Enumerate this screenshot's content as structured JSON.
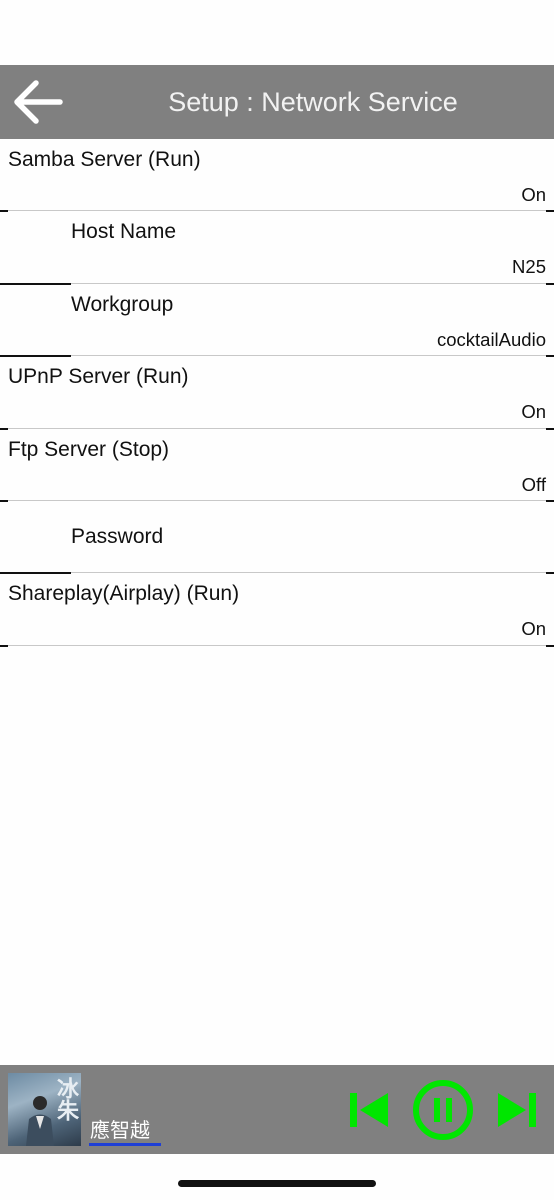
{
  "header": {
    "title": "Setup : Network Service",
    "back_icon": "arrow-left-icon"
  },
  "settings": [
    {
      "title": "Samba Server (Run)",
      "value": "On",
      "indent": false
    },
    {
      "title": "Host Name",
      "value": "N25",
      "indent": true
    },
    {
      "title": "Workgroup",
      "value": "cocktailAudio",
      "indent": true
    },
    {
      "title": "UPnP Server (Run)",
      "value": "On",
      "indent": false
    },
    {
      "title": "Ftp Server (Stop)",
      "value": "Off",
      "indent": false
    },
    {
      "title": "Password",
      "value": "",
      "indent": true
    },
    {
      "title": "Shareplay(Airplay) (Run)",
      "value": "On",
      "indent": false
    }
  ],
  "player": {
    "artist": "應智越",
    "album_art_text": "冰朱",
    "controls": {
      "prev_icon": "skip-previous-icon",
      "pause_icon": "pause-circle-icon",
      "next_icon": "skip-next-icon"
    },
    "accent_color": "#00e600",
    "underline_color": "#1e3fd6"
  },
  "colors": {
    "header_bg": "#808080",
    "header_text": "#f2f2f2",
    "page_bg": "#fefefe"
  }
}
